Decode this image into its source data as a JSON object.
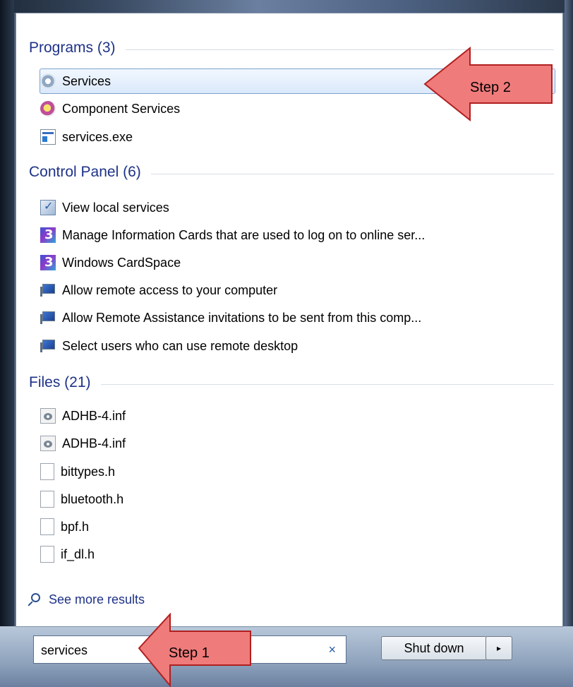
{
  "programs": {
    "header": "Programs (3)",
    "items": [
      {
        "label": "Services",
        "icon": "services-gear-icon"
      },
      {
        "label": "Component Services",
        "icon": "component-services-icon"
      },
      {
        "label": "services.exe",
        "icon": "exe-icon"
      }
    ]
  },
  "control_panel": {
    "header": "Control Panel (6)",
    "items": [
      {
        "label": "View local services",
        "icon": "view-services-icon"
      },
      {
        "label": "Manage Information Cards that are used to log on to online ser...",
        "icon": "cardspace-icon"
      },
      {
        "label": "Windows CardSpace",
        "icon": "cardspace-icon"
      },
      {
        "label": "Allow remote access to your computer",
        "icon": "remote-icon"
      },
      {
        "label": "Allow Remote Assistance invitations to be sent from this comp...",
        "icon": "remote-icon"
      },
      {
        "label": "Select users who can use remote desktop",
        "icon": "remote-icon"
      }
    ]
  },
  "files": {
    "header": "Files (21)",
    "items": [
      {
        "label": "ADHB-4.inf",
        "icon": "inf-file-icon"
      },
      {
        "label": "ADHB-4.inf",
        "icon": "inf-file-icon"
      },
      {
        "label": "bittypes.h",
        "icon": "file-icon"
      },
      {
        "label": "bluetooth.h",
        "icon": "file-icon"
      },
      {
        "label": "bpf.h",
        "icon": "file-icon"
      },
      {
        "label": "if_dl.h",
        "icon": "file-icon"
      }
    ]
  },
  "see_more": "See more results",
  "search": {
    "value": "services",
    "clear_symbol": "×"
  },
  "shutdown": {
    "label": "Shut down",
    "arrow": "▸"
  },
  "annotations": {
    "step1": "Step 1",
    "step2": "Step 2"
  },
  "colors": {
    "section_header": "#1e3287",
    "arrow_fill": "#f07b7b",
    "arrow_stroke": "#b02020",
    "selection_border": "#7da2ce"
  }
}
